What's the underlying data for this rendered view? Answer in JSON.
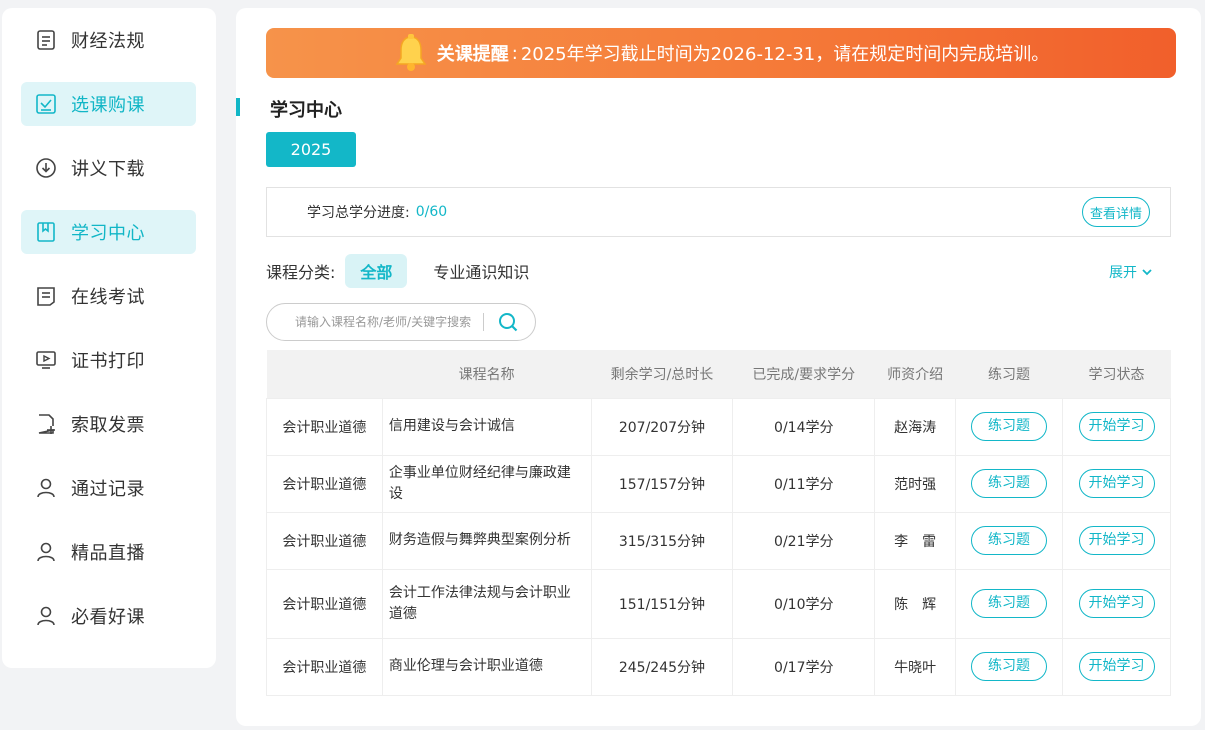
{
  "sidebar": {
    "items": [
      {
        "label": "财经法规",
        "icon": "document-icon",
        "active": false
      },
      {
        "label": "选课购课",
        "icon": "checkbox-icon",
        "active": true
      },
      {
        "label": "讲义下载",
        "icon": "download-icon",
        "active": false
      },
      {
        "label": "学习中心",
        "icon": "book-icon",
        "active": true
      },
      {
        "label": "在线考试",
        "icon": "exam-icon",
        "active": false
      },
      {
        "label": "证书打印",
        "icon": "monitor-icon",
        "active": false
      },
      {
        "label": "索取发票",
        "icon": "invoice-icon",
        "active": false
      },
      {
        "label": "通过记录",
        "icon": "user-icon",
        "active": false
      },
      {
        "label": "精品直播",
        "icon": "user-icon",
        "active": false
      },
      {
        "label": "必看好课",
        "icon": "user-icon",
        "active": false
      }
    ]
  },
  "notice": {
    "title": "关课提醒",
    "colon": ":",
    "text": "2025年学习截止时间为2026-12-31，请在规定时间内完成培训。"
  },
  "section": {
    "title": "学习中心"
  },
  "year_tab": "2025",
  "progress": {
    "label": "学习总学分进度:",
    "value": "0/60",
    "detail_button": "查看详情"
  },
  "category": {
    "label": "课程分类:",
    "all": "全部",
    "option": "专业通识知识",
    "expand": "展开"
  },
  "search": {
    "placeholder": "请输入课程名称/老师/关键字搜索"
  },
  "table": {
    "headers": [
      "",
      "课程名称",
      "剩余学习/总时长",
      "已完成/要求学分",
      "师资介绍",
      "练习题",
      "学习状态"
    ],
    "rows": [
      {
        "category": "会计职业道德",
        "name": "信用建设与会计诚信",
        "duration": "207/207分钟",
        "credits": "0/14学分",
        "teacher": "赵海涛",
        "exercise": "练习题",
        "status": "开始学习"
      },
      {
        "category": "会计职业道德",
        "name": "企事业单位财经纪律与廉政建设",
        "duration": "157/157分钟",
        "credits": "0/11学分",
        "teacher": "范时强",
        "exercise": "练习题",
        "status": "开始学习"
      },
      {
        "category": "会计职业道德",
        "name": "财务造假与舞弊典型案例分析",
        "duration": "315/315分钟",
        "credits": "0/21学分",
        "teacher": "李　雷",
        "exercise": "练习题",
        "status": "开始学习"
      },
      {
        "category": "会计职业道德",
        "name": "会计工作法律法规与会计职业道德",
        "duration": "151/151分钟",
        "credits": "0/10学分",
        "teacher": "陈　辉",
        "exercise": "练习题",
        "status": "开始学习"
      },
      {
        "category": "会计职业道德",
        "name": "商业伦理与会计职业道德",
        "duration": "245/245分钟",
        "credits": "0/17学分",
        "teacher": "牛晓叶",
        "exercise": "练习题",
        "status": "开始学习"
      }
    ]
  },
  "colors": {
    "accent": "#13b7c8",
    "active_bg": "#dff5f8",
    "notice_start": "#f6934a",
    "notice_end": "#f15f2b"
  }
}
